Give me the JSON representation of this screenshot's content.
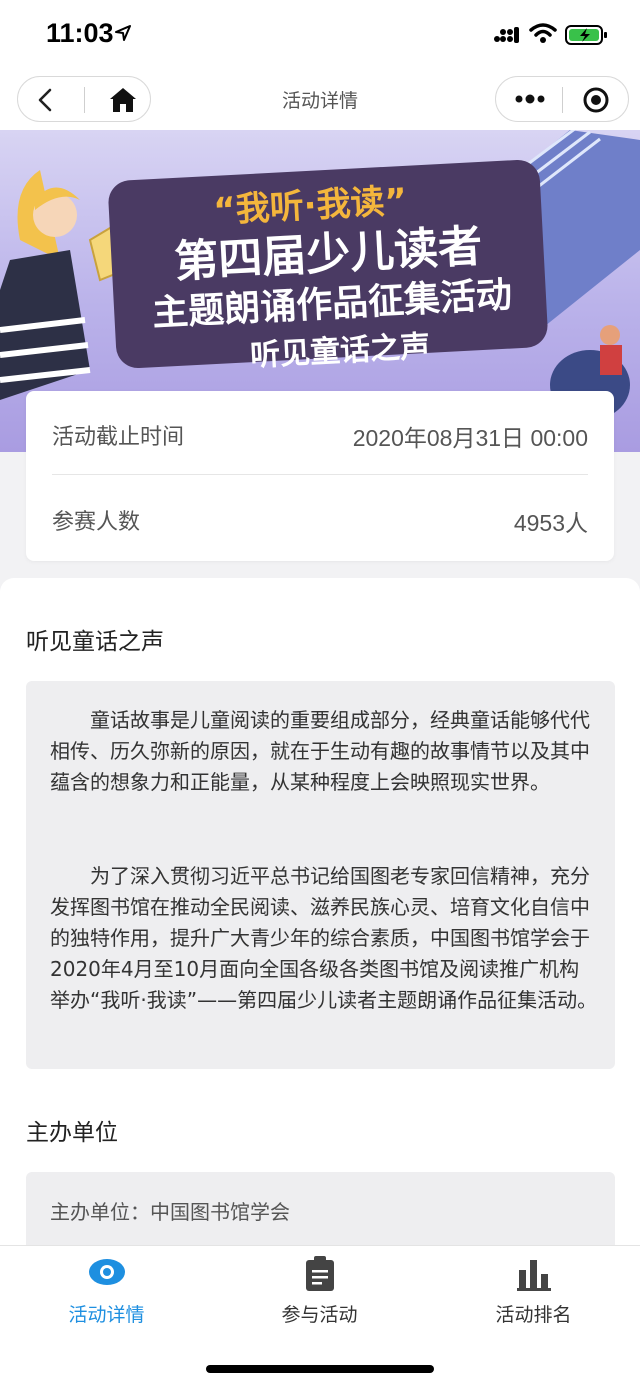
{
  "status_bar": {
    "time": "11:03",
    "icons": [
      "location-arrow-icon",
      "signal-icon",
      "wifi-icon",
      "battery-charging-icon"
    ]
  },
  "nav": {
    "title": "活动详情",
    "icons": [
      "back-icon",
      "home-icon",
      "more-icon",
      "close-mini-program-icon"
    ]
  },
  "banner": {
    "line1": "“我听·我读”",
    "line2": "第四届少儿读者",
    "line3": "主题朗诵作品征集活动",
    "line4": "听见童话之声"
  },
  "info": {
    "deadline_label": "活动截止时间",
    "deadline_value": "2020年08月31日 00:00",
    "participants_label": "参赛人数",
    "participants_value": "4953人"
  },
  "intro": {
    "title": "听见童话之声",
    "p1": "童话故事是儿童阅读的重要组成部分，经典童话能够代代相传、历久弥新的原因，就在于生动有趣的故事情节以及其中蕴含的想象力和正能量，从某种程度上会映照现实世界。",
    "p2": "为了深入贯彻习近平总书记给国图老专家回信精神，充分发挥图书馆在推动全民阅读、滋养民族心灵、培育文化自信中的独特作用，提升广大青少年的综合素质，中国图书馆学会于2020年4月至10月面向全国各级各类图书馆及阅读推广机构举办“我听·我读”——第四届少儿读者主题朗诵作品征集活动。"
  },
  "host": {
    "title": "主办单位",
    "text": "主办单位：中国图书馆学会"
  },
  "tabs": [
    {
      "label": "活动详情",
      "icon": "eye-icon",
      "active": true
    },
    {
      "label": "参与活动",
      "icon": "clipboard-icon",
      "active": false
    },
    {
      "label": "活动排名",
      "icon": "bar-chart-icon",
      "active": false
    }
  ],
  "colors": {
    "accent": "#1e8fe0",
    "banner_bg": "#bab2ea",
    "banner_title_box": "#4a3a63",
    "banner_highlight": "#f4b63c"
  }
}
